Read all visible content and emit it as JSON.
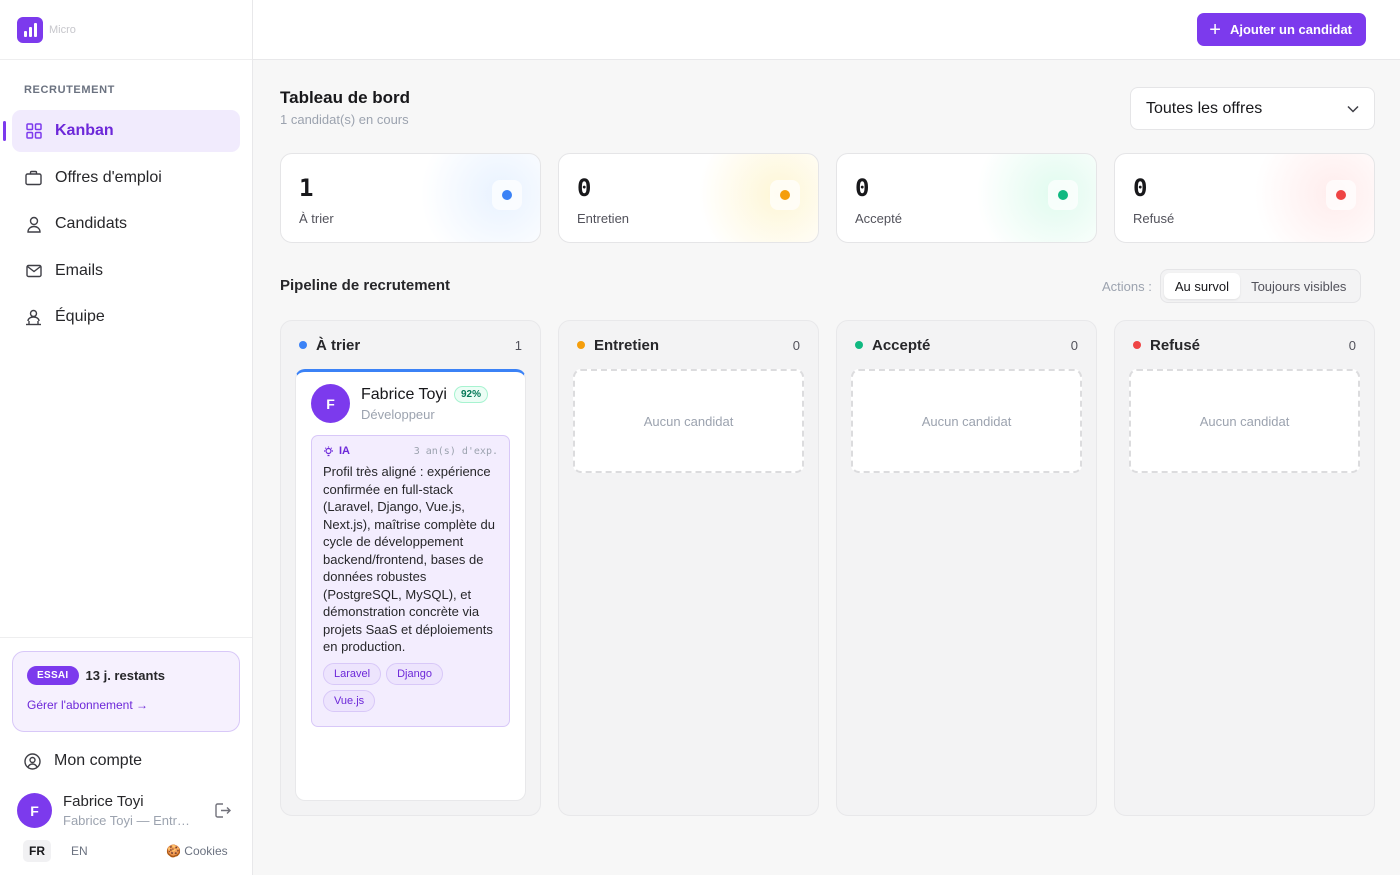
{
  "brand": {
    "name": "Micro"
  },
  "sidebar": {
    "section_label": "RECRUTEMENT",
    "items": [
      {
        "label": "Kanban",
        "icon": "grid-icon",
        "active": true
      },
      {
        "label": "Offres d'emploi",
        "icon": "briefcase-icon"
      },
      {
        "label": "Candidats",
        "icon": "user-icon"
      },
      {
        "label": "Emails",
        "icon": "mail-icon"
      },
      {
        "label": "Équipe",
        "icon": "team-icon"
      }
    ],
    "trial": {
      "badge": "ESSAI",
      "days_left": "13 j. restants",
      "link": "Gérer l'abonnement →"
    },
    "account_label": "Mon compte",
    "user": {
      "initial": "F",
      "name": "Fabrice Toyi",
      "subtitle": "Fabrice Toyi — Entreprise"
    },
    "languages": [
      "FR",
      "EN"
    ],
    "cookies_label": "🍪 Cookies"
  },
  "topbar": {
    "add_button": "Ajouter un candidat"
  },
  "dashboard": {
    "title": "Tableau de bord",
    "subtitle": "1 candidat(s) en cours",
    "filter": {
      "selected": "Toutes les offres"
    }
  },
  "stats": [
    {
      "value": "1",
      "label": "À trier",
      "color": "#3b82f6"
    },
    {
      "value": "0",
      "label": "Entretien",
      "color": "#f59e0b"
    },
    {
      "value": "0",
      "label": "Accepté",
      "color": "#10b981"
    },
    {
      "value": "0",
      "label": "Refusé",
      "color": "#ef4444"
    }
  ],
  "pipeline": {
    "title": "Pipeline de recrutement",
    "actions_label": "Actions :",
    "modes": [
      "Au survol",
      "Toujours visibles"
    ],
    "active_mode": "Au survol",
    "columns": [
      {
        "title": "À trier",
        "count": "1",
        "color": "#3b82f6"
      },
      {
        "title": "Entretien",
        "count": "0",
        "color": "#f59e0b",
        "empty": "Aucun candidat"
      },
      {
        "title": "Accepté",
        "count": "0",
        "color": "#10b981",
        "empty": "Aucun candidat"
      },
      {
        "title": "Refusé",
        "count": "0",
        "color": "#ef4444",
        "empty": "Aucun candidat"
      }
    ],
    "card": {
      "initial": "F",
      "name": "Fabrice Toyi",
      "score": "92%",
      "role": "Développeur",
      "ai_label": "IA",
      "experience": "3 an(s) d'exp.",
      "summary": "Profil très aligné : expérience confirmée en full-stack (Laravel, Django, Vue.js, Next.js), maîtrise complète du cycle de développement backend/frontend, bases de données robustes (PostgreSQL, MySQL), et démonstration concrète via projets SaaS et déploiements en production.",
      "tags": [
        "Laravel",
        "Django",
        "Vue.js"
      ]
    }
  }
}
